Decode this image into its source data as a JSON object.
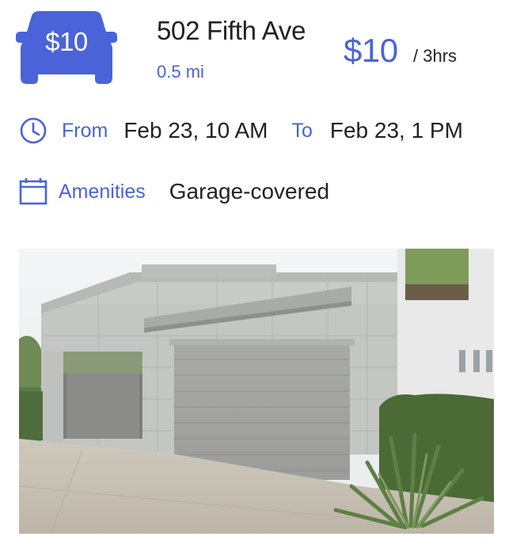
{
  "badge": {
    "price": "$10",
    "icon": "car-icon",
    "color": "#4a63d8"
  },
  "listing": {
    "address": "502 Fifth Ave",
    "distance": "0.5 mi",
    "price": "$10",
    "duration": "/ 3hrs"
  },
  "time": {
    "icon": "clock-icon",
    "from_label": "From",
    "from_value": "Feb 23, 10 AM",
    "to_label": "To",
    "to_value": "Feb 23, 1 PM"
  },
  "amenities": {
    "icon": "calendar-icon",
    "label": "Amenities",
    "value": "Garage-covered"
  },
  "photo": {
    "subject": "garage-photo"
  },
  "colors": {
    "accent": "#4a63d8",
    "text": "#222222",
    "background": "#ffffff"
  }
}
